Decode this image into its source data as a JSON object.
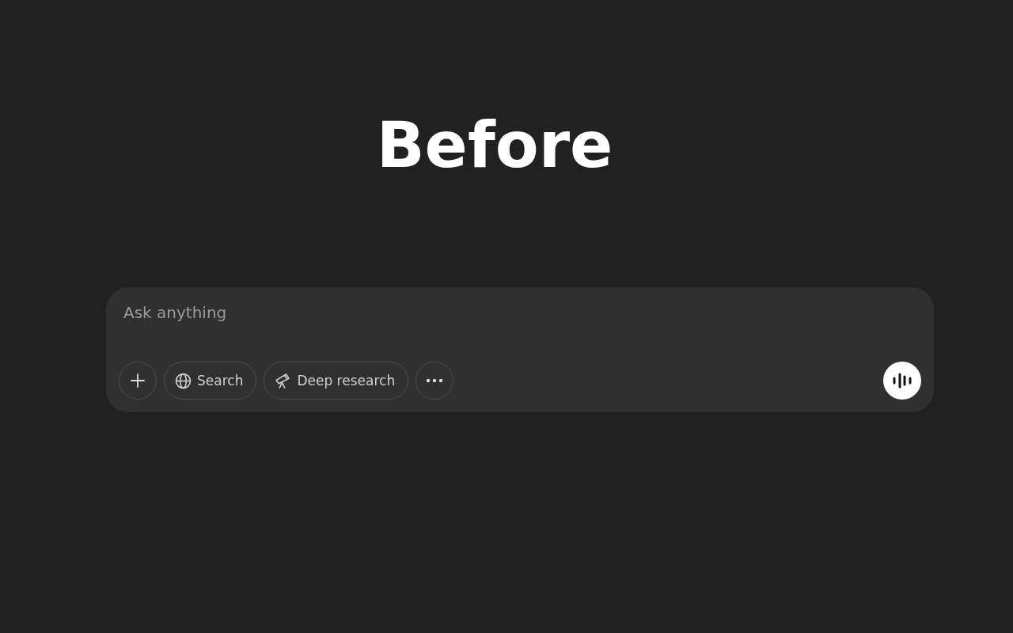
{
  "heading": "Before",
  "composer": {
    "placeholder": "Ask anything",
    "tools": [
      {
        "kind": "round"
      },
      {
        "kind": "pill",
        "label": "Search"
      },
      {
        "kind": "pill",
        "label": "Deep research"
      },
      {
        "kind": "round"
      }
    ]
  }
}
